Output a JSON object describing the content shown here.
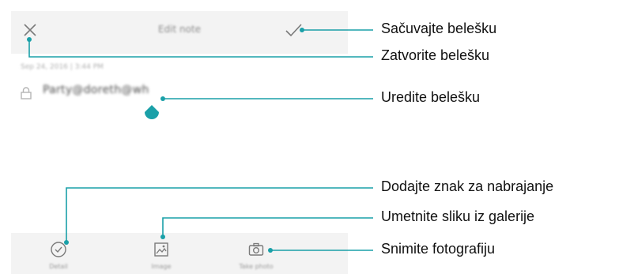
{
  "phone": {
    "title": "Edit note",
    "date": "Sep 24, 2016 | 3:44 PM",
    "note_text": "Party@doreth@wh",
    "toolbar": [
      {
        "label": "Detail",
        "icon": "check-circle-icon"
      },
      {
        "label": "Image",
        "icon": "image-icon"
      },
      {
        "label": "Take photo",
        "icon": "camera-icon"
      }
    ]
  },
  "callouts": {
    "save": "Sačuvajte belešku",
    "close": "Zatvorite belešku",
    "edit": "Uredite belešku",
    "bullet": "Dodajte znak za nabrajanje",
    "image": "Umetnite sliku iz galerije",
    "photo": "Snimite fotografiju"
  },
  "colors": {
    "accent": "#1aa0a8",
    "bar_background": "#f3f3f3",
    "icon": "#7a7a7a"
  }
}
